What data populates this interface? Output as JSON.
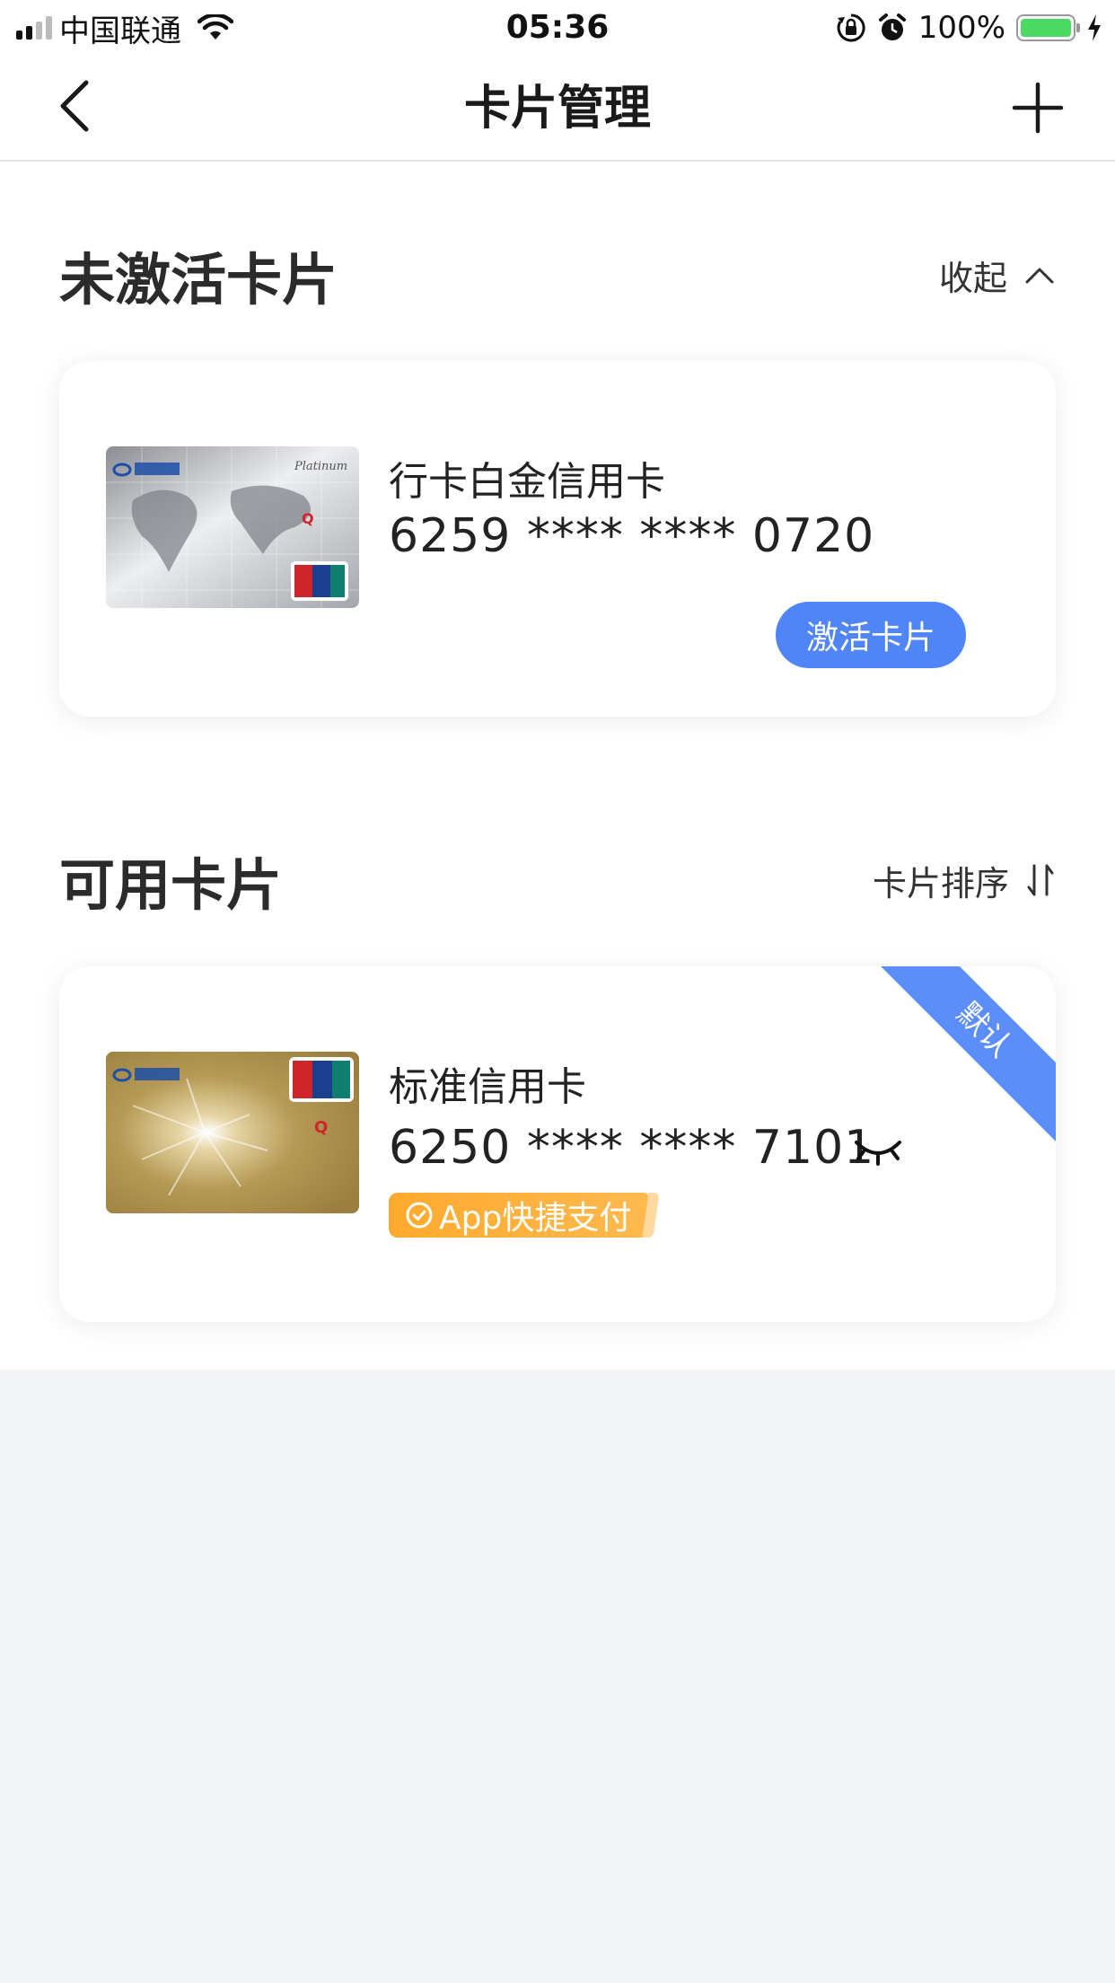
{
  "status_bar": {
    "carrier": "中国联通",
    "time": "05:36",
    "battery": "100%"
  },
  "nav": {
    "title": "卡片管理"
  },
  "inactive_section": {
    "title": "未激活卡片",
    "action_label": "收起",
    "card": {
      "name": "行卡白金信用卡",
      "number": "6259 **** **** 0720",
      "activate_label": "激活卡片"
    }
  },
  "available_section": {
    "title": "可用卡片",
    "action_label": "卡片排序",
    "card": {
      "name": "标准信用卡",
      "number": "6250 **** **** 7101",
      "tag_label": "App快捷支付",
      "default_badge": "默认"
    }
  },
  "colors": {
    "accent": "#4f85f7",
    "tag": "#ffaa2e",
    "page_bg": "#f2f3f7"
  },
  "icons": [
    "signal-icon",
    "wifi-icon",
    "lock-rotation-icon",
    "alarm-icon",
    "battery-icon",
    "charging-icon",
    "back-icon",
    "add-icon",
    "chevron-up-icon",
    "sort-icon",
    "eye-closed-icon",
    "check-circle-icon"
  ]
}
